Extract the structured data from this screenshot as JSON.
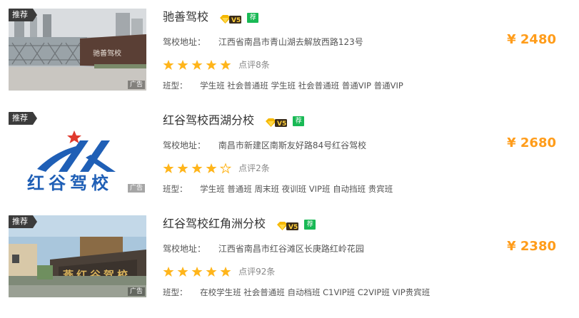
{
  "colors": {
    "price": "#ff9c1a",
    "star_on": "#ffb51b",
    "star_off": "#ffb51b",
    "tag_bg": "#3b3b3b",
    "jian_badge": "#19b955"
  },
  "schools": [
    {
      "tag": "推荐",
      "ad_label": "广告",
      "name": "驰善驾校",
      "badge_v": "V5",
      "badge_jian": "荐",
      "address_label": "驾校地址：",
      "address": "江西省南昌市青山湖去解放西路123号",
      "rating": 5,
      "review_count": "点评8条",
      "classes_label": "班型：",
      "classes": "学生班 社会普通班 学生班 社会普通班 普通VIP 普通VIP",
      "price": "¥ 2480",
      "image_sign": "驰善驾校"
    },
    {
      "tag": "推荐",
      "ad_label": "广告",
      "name": "红谷驾校西湖分校",
      "badge_v": "V5",
      "badge_jian": "荐",
      "address_label": "驾校地址：",
      "address": "南昌市新建区南斯友好路84号红谷驾校",
      "rating": 4,
      "review_count": "点评2条",
      "classes_label": "班型：",
      "classes": "学生班 普通班 周末班 夜训班 VIP班 自动挡班 贵宾班",
      "price": "¥ 2680",
      "image_sign": "红谷驾校"
    },
    {
      "tag": "推荐",
      "ad_label": "广告",
      "name": "红谷驾校红角洲分校",
      "badge_v": "V5",
      "badge_jian": "荐",
      "address_label": "驾校地址：",
      "address": "江西省南昌市红谷滩区长庚路红岭花园",
      "rating": 5,
      "review_count": "点评92条",
      "classes_label": "班型：",
      "classes": "在校学生班 社会普通班 自动档班 C1VIP班 C2VIP班 VIP贵宾班",
      "price": "¥ 2380",
      "image_sign": "燕红谷驾校"
    }
  ]
}
